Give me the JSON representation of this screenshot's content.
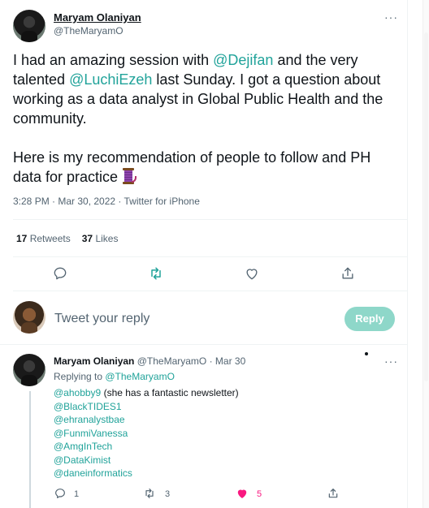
{
  "tweet": {
    "author_name": "Maryam Olaniyan",
    "author_handle": "@TheMaryamO",
    "text_p1_a": "I had an amazing session with ",
    "mention_1": "@Dejifan",
    "text_p1_b": " and the very talented ",
    "mention_2": "@LuchiEzeh",
    "text_p1_c": " last Sunday. I got a question about working as a data analyst in Global Public Health and the community.",
    "text_p2": "Here is my recommendation of people to follow and PH data for practice",
    "emoji_icon": "spool-of-thread-icon",
    "timestamp": "3:28 PM · Mar 30, 2022 · Twitter for iPhone",
    "retweets_count": "17",
    "retweets_label": "Retweets",
    "likes_count": "37",
    "likes_label": "Likes"
  },
  "actions": [
    "reply-icon",
    "retweet-icon",
    "like-icon",
    "share-icon"
  ],
  "compose": {
    "placeholder": "Tweet your reply",
    "button_label": "Reply",
    "button_color": "#8ed7c9"
  },
  "reply": {
    "author_name": "Maryam Olaniyan",
    "author_handle_time": "@TheMaryamO · Mar 30",
    "replying_prefix": "Replying to ",
    "replying_to": "@TheMaryamO",
    "lines": [
      {
        "mention": "@ahobby9",
        "rest": " (she has a fantastic newsletter)"
      },
      {
        "mention": "@BlackTIDES1",
        "rest": ""
      },
      {
        "mention": "@ehranalystbae",
        "rest": ""
      },
      {
        "mention": "@FunmiVanessa",
        "rest": ""
      },
      {
        "mention": "@AmgInTech",
        "rest": ""
      },
      {
        "mention": "@DataKimist",
        "rest": ""
      },
      {
        "mention": "@daneinformatics",
        "rest": ""
      }
    ],
    "reply_count": "1",
    "retweet_count": "3",
    "like_count": "5"
  },
  "colors": {
    "accent": "#21a39a",
    "like_active": "#f91880",
    "muted_text": "#536471"
  }
}
